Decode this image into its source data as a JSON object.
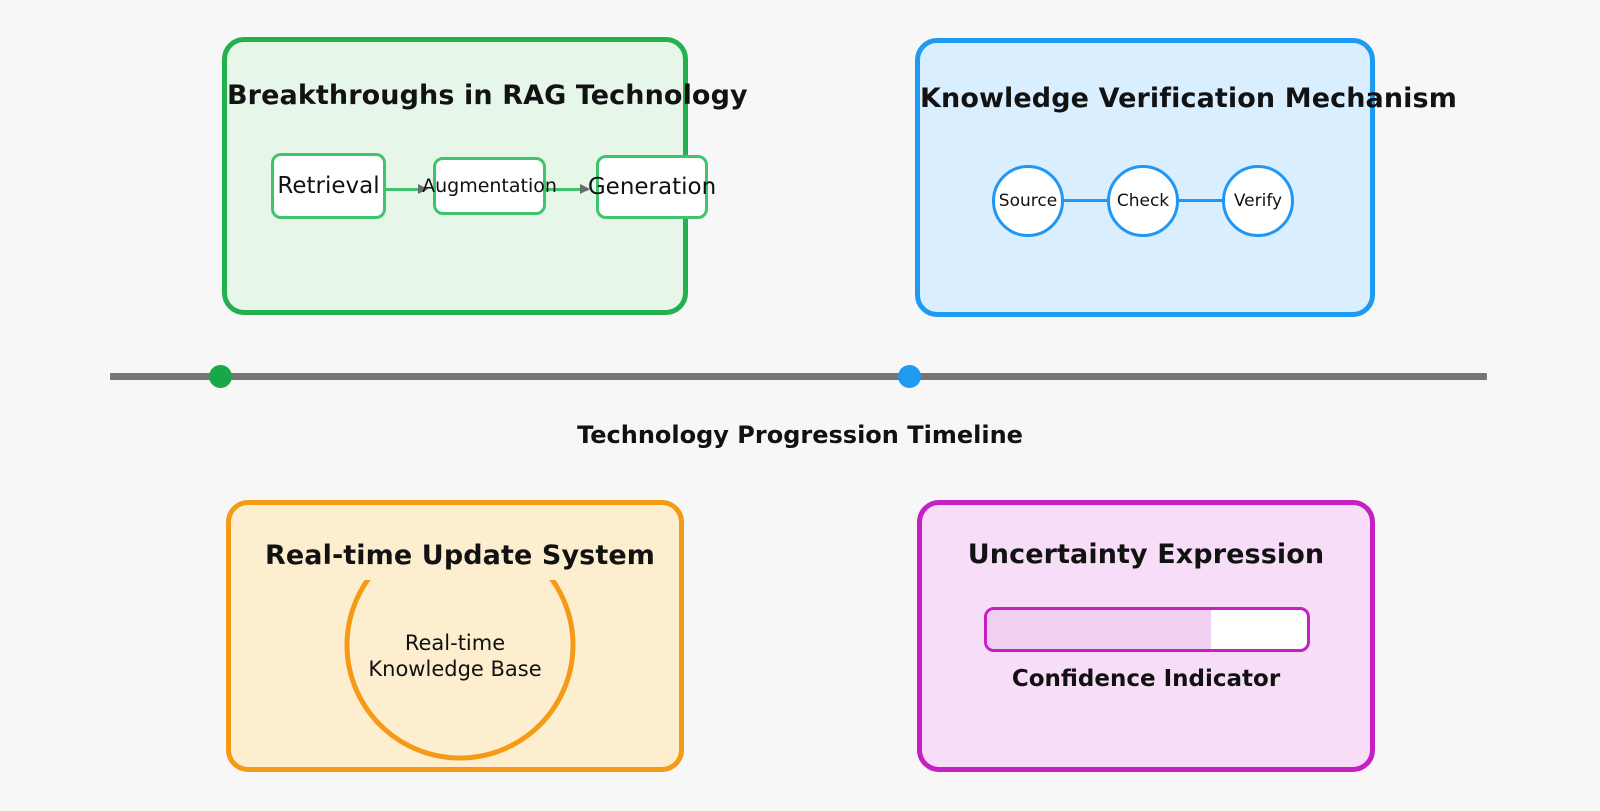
{
  "background_color": "#f7f7f7",
  "panels": {
    "rag": {
      "title": "Breakthroughs in RAG Technology",
      "border_color": "#22b14c",
      "fill_color": "#e6f6e9",
      "flow_steps": [
        {
          "label": "Retrieval"
        },
        {
          "label": "Augmentation"
        },
        {
          "label": "Generation"
        }
      ]
    },
    "verification": {
      "title": "Knowledge Verification Mechanism",
      "border_color": "#1e9bf0",
      "fill_color": "#d9efff",
      "nodes": [
        {
          "label": "Source"
        },
        {
          "label": "Check"
        },
        {
          "label": "Verify"
        }
      ]
    },
    "update": {
      "title": "Real-time Update System",
      "border_color": "#f59a16",
      "fill_color": "#fdeecf",
      "center_label_line1": "Real-time",
      "center_label_line2": "Knowledge Base",
      "cycle_color": "#f59a16"
    },
    "uncertainty": {
      "title": "Uncertainty Expression",
      "border_color": "#c420c4",
      "fill_color": "#f7ddf7",
      "bar_caption": "Confidence Indicator",
      "bar_fill_percent": 70,
      "bar_fill_color": "#f0d0f0"
    }
  },
  "timeline": {
    "caption": "Technology Progression Timeline",
    "track_color": "#757575",
    "markers": [
      {
        "name": "rag-milestone",
        "color": "#18a84a",
        "position_percent": 8
      },
      {
        "name": "verification-milestone",
        "color": "#1e9bf0",
        "position_percent": 58
      }
    ]
  }
}
